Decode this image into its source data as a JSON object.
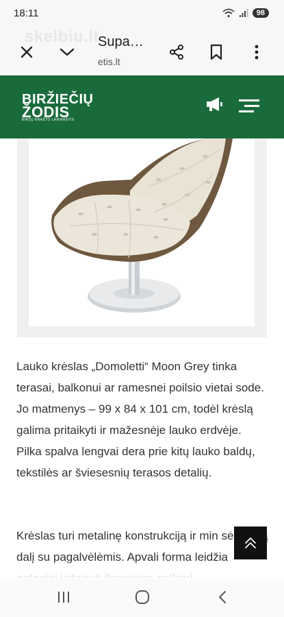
{
  "status_bar": {
    "time": "18:11",
    "battery": "98"
  },
  "browser": {
    "page_title": "Supa…",
    "domain": "etis.lt",
    "watermark": "skelbiu.lt"
  },
  "site": {
    "logo_line1": "BIRŽIEČIŲ",
    "logo_line2": "ŽODIS",
    "logo_tagline": "BIRŽŲ KRAŠTO LAIKRAŠTIS"
  },
  "article": {
    "paragraph1": "Lauko krėslas „Domoletti“ Moon Grey tinka terasai, balkonui ar ramesnei poilsio vietai sode. Jo matmenys – 99 x 84 x 101 cm, todėl krėslą galima pritaikyti ir mažesnėje lauko erdvėje. Pilka spalva lengvai dera prie kitų lauko baldų, tekstilės ar šviesesnių terasos detalių.",
    "paragraph2": "Krėslas turi metalinę konstrukciją ir min sėdimąją dalį su pagalvėlėmis. Apvali forma leidžia patogiai įsitaisyti ilgesniam poilsiui"
  },
  "colors": {
    "header_green": "#1a6b3b"
  },
  "icons": [
    "wifi-icon",
    "signal-icon",
    "close-icon",
    "chevron-down-icon",
    "share-icon",
    "bookmark-icon",
    "more-icon",
    "megaphone-icon",
    "menu-icon",
    "arrow-up-icon",
    "recents-icon",
    "home-icon",
    "back-icon"
  ]
}
